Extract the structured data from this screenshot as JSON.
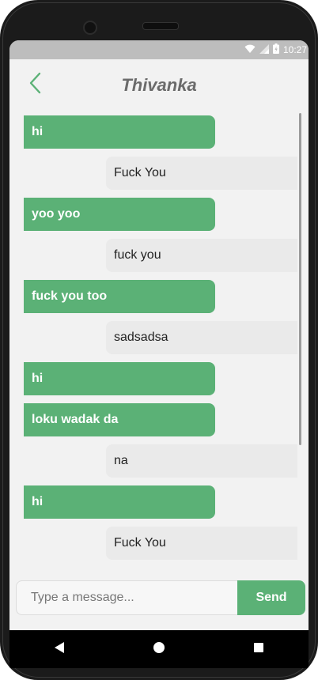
{
  "status_bar": {
    "time": "10:27",
    "icons": [
      "wifi-icon",
      "signal-icon",
      "battery-icon"
    ]
  },
  "header": {
    "title": "Thivanka",
    "back_icon": "chevron-left-icon"
  },
  "messages": [
    {
      "type": "sent",
      "text": "hi"
    },
    {
      "type": "received",
      "text": "Fuck You"
    },
    {
      "type": "sent",
      "text": "yoo yoo"
    },
    {
      "type": "received",
      "text": "fuck you"
    },
    {
      "type": "sent",
      "text": "fuck you too"
    },
    {
      "type": "received",
      "text": "sadsadsa"
    },
    {
      "type": "sent",
      "text": "hi"
    },
    {
      "type": "sent",
      "text": "loku wadak da"
    },
    {
      "type": "received",
      "text": "na"
    },
    {
      "type": "sent",
      "text": "hi"
    },
    {
      "type": "received",
      "text": "Fuck You"
    }
  ],
  "composer": {
    "placeholder": "Type a message...",
    "value": "",
    "send_label": "Send"
  },
  "nav_bar": {
    "buttons": [
      "back-triangle-icon",
      "home-circle-icon",
      "recents-square-icon"
    ]
  },
  "colors": {
    "accent": "#5bb176",
    "received_bubble": "#eaeaea",
    "title": "#6b6b6b",
    "background": "#f2f2f2"
  }
}
